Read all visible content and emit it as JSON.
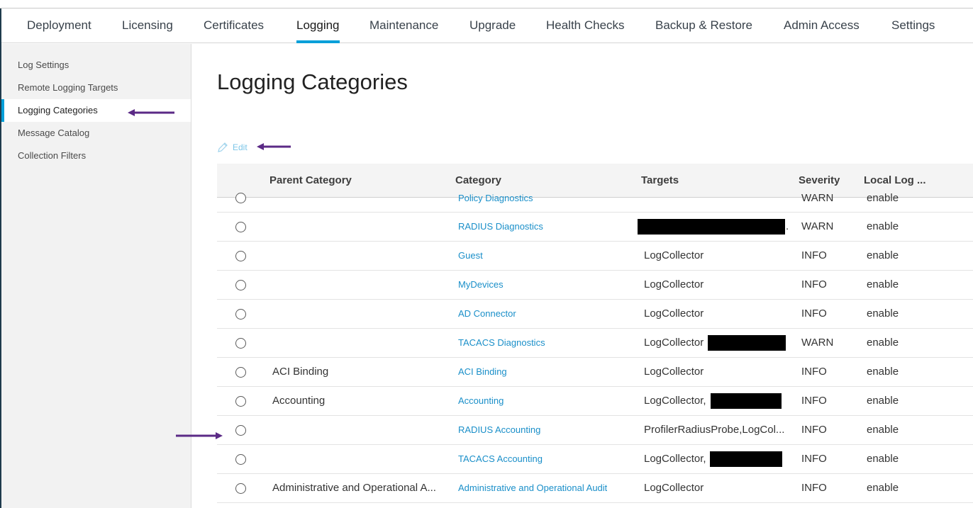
{
  "top_tabs": [
    {
      "label": "Deployment"
    },
    {
      "label": "Licensing"
    },
    {
      "label": "Certificates"
    },
    {
      "label": "Logging"
    },
    {
      "label": "Maintenance"
    },
    {
      "label": "Upgrade"
    },
    {
      "label": "Health Checks"
    },
    {
      "label": "Backup & Restore"
    },
    {
      "label": "Admin Access"
    },
    {
      "label": "Settings"
    }
  ],
  "active_tab": "Logging",
  "sidebar": {
    "items": [
      {
        "label": "Log Settings"
      },
      {
        "label": "Remote Logging Targets"
      },
      {
        "label": "Logging Categories"
      },
      {
        "label": "Message Catalog"
      },
      {
        "label": "Collection Filters"
      }
    ],
    "active": "Logging Categories"
  },
  "page_title": "Logging Categories",
  "toolbar": {
    "edit_label": "Edit",
    "edit_icon": "pencil-icon"
  },
  "table": {
    "columns": [
      "Parent Category",
      "Category",
      "Targets",
      "Severity",
      "Local Log ..."
    ],
    "rows": [
      {
        "parent": "",
        "category": "Policy Diagnostics",
        "targets": "",
        "severity": "WARN",
        "local": "enable"
      },
      {
        "parent": "",
        "category": "RADIUS Diagnostics",
        "targets": ".",
        "severity": "WARN",
        "local": "enable"
      },
      {
        "parent": "",
        "category": "Guest",
        "targets": "LogCollector",
        "severity": "INFO",
        "local": "enable"
      },
      {
        "parent": "",
        "category": "MyDevices",
        "targets": "LogCollector",
        "severity": "INFO",
        "local": "enable"
      },
      {
        "parent": "",
        "category": "AD Connector",
        "targets": "LogCollector",
        "severity": "INFO",
        "local": "enable"
      },
      {
        "parent": "",
        "category": "TACACS Diagnostics",
        "targets": "LogCollector",
        "severity": "WARN",
        "local": "enable"
      },
      {
        "parent": "ACI Binding",
        "category": "ACI Binding",
        "targets": "LogCollector",
        "severity": "INFO",
        "local": "enable"
      },
      {
        "parent": "Accounting",
        "category": "Accounting",
        "targets": "LogCollector,",
        "severity": "INFO",
        "local": "enable"
      },
      {
        "parent": "",
        "category": "RADIUS Accounting",
        "targets": "ProfilerRadiusProbe,LogCol...",
        "severity": "INFO",
        "local": "enable"
      },
      {
        "parent": "",
        "category": "TACACS Accounting",
        "targets": "LogCollector,",
        "severity": "INFO",
        "local": "enable"
      },
      {
        "parent": "Administrative and Operational A...",
        "category": "Administrative and Operational Audit",
        "targets": "LogCollector",
        "severity": "INFO",
        "local": "enable"
      }
    ]
  },
  "colors": {
    "accent": "#049fd9",
    "link": "#1a8fc9",
    "annotation_arrow": "#5b2a86",
    "redaction": "#000000"
  }
}
